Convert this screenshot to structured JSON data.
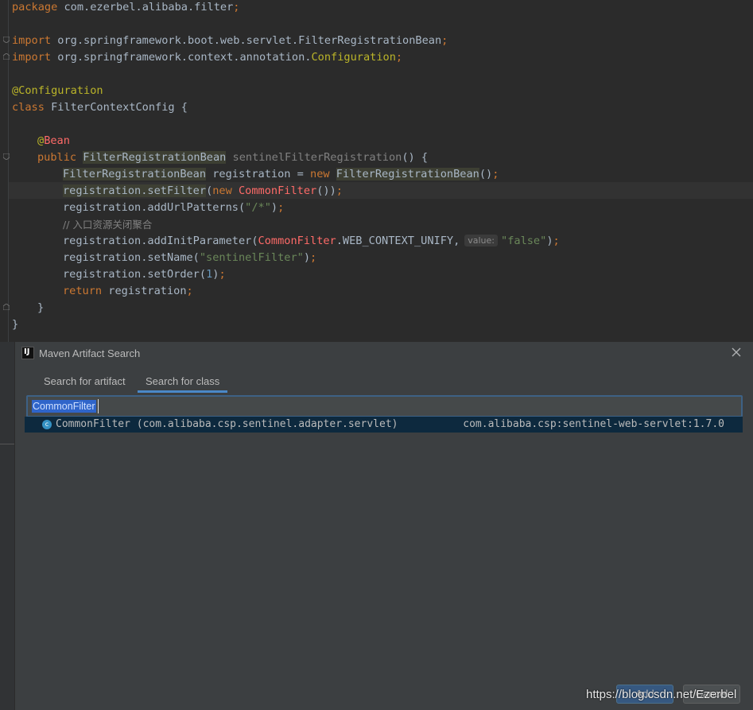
{
  "editor": {
    "lines": {
      "l1": {
        "kw": "package",
        "rest": " com.ezerbel.alibaba.filter",
        "semi": ";"
      },
      "l3": {
        "kw": "import",
        "rest": " org.springframework.boot.web.servlet.FilterRegistrationBean",
        "semi": ";"
      },
      "l4": {
        "kw": "import",
        "rest": " org.springframework.context.annotation.",
        "cls": "Configuration",
        "semi": ";"
      },
      "l6": {
        "ann": "@Configuration"
      },
      "l7": {
        "kw": "class",
        "rest": " FilterContextConfig {"
      },
      "l9": {
        "at": "@",
        "ann": "Bean"
      },
      "l10": {
        "kw": "public",
        "type": "FilterRegistrationBean",
        "method": " sentinelFilterRegistration",
        "rest": "() {"
      },
      "l11": {
        "type": "FilterRegistrationBean",
        "mid": " registration = ",
        "kw": "new",
        "sp": " ",
        "type2": "FilterRegistrationBean",
        "rest": "()",
        "semi": ";"
      },
      "l12": {
        "pre": "registration.setFilter",
        "rest": "(",
        "kw": "new",
        "sp": " ",
        "err": "CommonFilter",
        "rest2": "())",
        "semi": ";"
      },
      "l13": {
        "pre": "registration.addUrlPatterns(",
        "str": "\"/*\"",
        "rest": ")",
        "semi": ";"
      },
      "l14": {
        "cmt": "// 入口资源关闭聚合"
      },
      "l15": {
        "pre": "registration.addInitParameter(",
        "err": "CommonFilter",
        "mid": ".WEB_CONTEXT_UNIFY,",
        "hint": "value:",
        "str": "\"false\"",
        "rest": ")",
        "semi": ";"
      },
      "l16": {
        "pre": "registration.setName(",
        "str": "\"sentinelFilter\"",
        "rest": ")",
        "semi": ";"
      },
      "l17": {
        "pre": "registration.setOrder(",
        "num": "1",
        "rest": ")",
        "semi": ";"
      },
      "l18": {
        "kw": "return",
        "rest": " registration",
        "semi": ";"
      },
      "l19": {
        "rest": "}"
      },
      "l20": {
        "rest": "}"
      }
    }
  },
  "dialog": {
    "title": "Maven Artifact Search",
    "icon_label": "IJ",
    "tabs": [
      {
        "label": "Search for artifact"
      },
      {
        "label": "Search for class"
      }
    ],
    "active_tab": "Search for class",
    "search_value": "CommonFilter",
    "results": [
      {
        "badge": "c",
        "name": "CommonFilter (com.alibaba.csp.sentinel.adapter.servlet)",
        "coordinate": "com.alibaba.csp:sentinel-web-servlet:1.7.0"
      }
    ],
    "add_label": "Add",
    "cancel_label": "Cancel"
  },
  "watermark": "https://blog.csdn.net/Ezerbel",
  "colors": {
    "editor_bg": "#2b2b2b",
    "dialog_bg": "#3c3f41",
    "accent": "#4a88c7",
    "selection": "#0d293e"
  }
}
